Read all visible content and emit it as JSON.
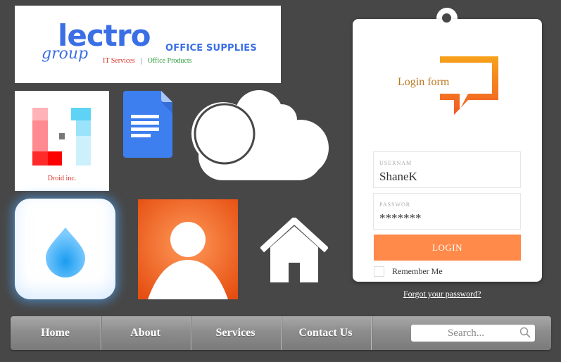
{
  "logo": {
    "brand": "lectro",
    "group": "group",
    "tagline": "OFFICE SUPPLIES",
    "services": "IT Services",
    "divider": "|",
    "products": "Office Products"
  },
  "droid": {
    "label": "Droid inc."
  },
  "login": {
    "title": "Login form",
    "username_label": "USERNAM",
    "username_value": "ShaneK",
    "password_label": "PASSWOR",
    "password_value": "*******",
    "button": "LOGIN",
    "remember": "Remember Me",
    "forgot": "Forgot your password?"
  },
  "nav": {
    "items": [
      {
        "label": "Home"
      },
      {
        "label": "About"
      },
      {
        "label": "Services"
      },
      {
        "label": "Contact Us"
      }
    ],
    "search_placeholder": "Search..."
  },
  "colors": {
    "background": "#474747",
    "accent_orange": "#ff8a4a",
    "brand_blue": "#3b6fe6",
    "nav_gray": "#8d8d8d"
  },
  "icons": [
    "doc-icon",
    "cloud-icon",
    "droplet-icon",
    "user-profile-icon",
    "home-icon",
    "speech-bubble-icon",
    "search-icon"
  ]
}
